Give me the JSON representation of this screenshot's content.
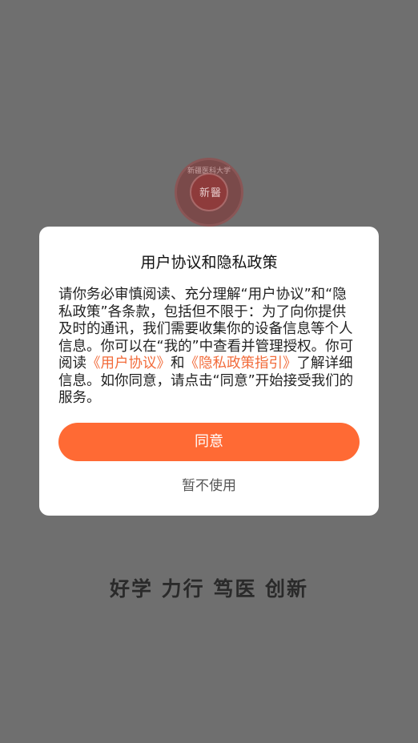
{
  "background": {
    "logo_text": "新醫",
    "logo_ring_text": "新疆医科大学",
    "motto": "好学 力行 笃医 创新"
  },
  "dialog": {
    "title": "用户协议和隐私政策",
    "body_part1": "请你务必审慎阅读、充分理解“用户协议”和“隐私政策”各条款，包括但不限于：为了向你提供及时的通讯，我们需要收集你的设备信息等个人信息。你可以在“我的”中查看并管理授权。你可阅读",
    "link_user_agreement": "《用户协议》",
    "body_and": "和",
    "link_privacy_guide": "《隐私政策指引》",
    "body_part2": "了解详细信息。如你同意，请点击“同意”开始接受我们的服务。",
    "agree_label": "同意",
    "decline_label": "暂不使用"
  },
  "colors": {
    "accent": "#ff6a34",
    "link": "#f26b3a",
    "overlay": "#6f6f6f"
  }
}
